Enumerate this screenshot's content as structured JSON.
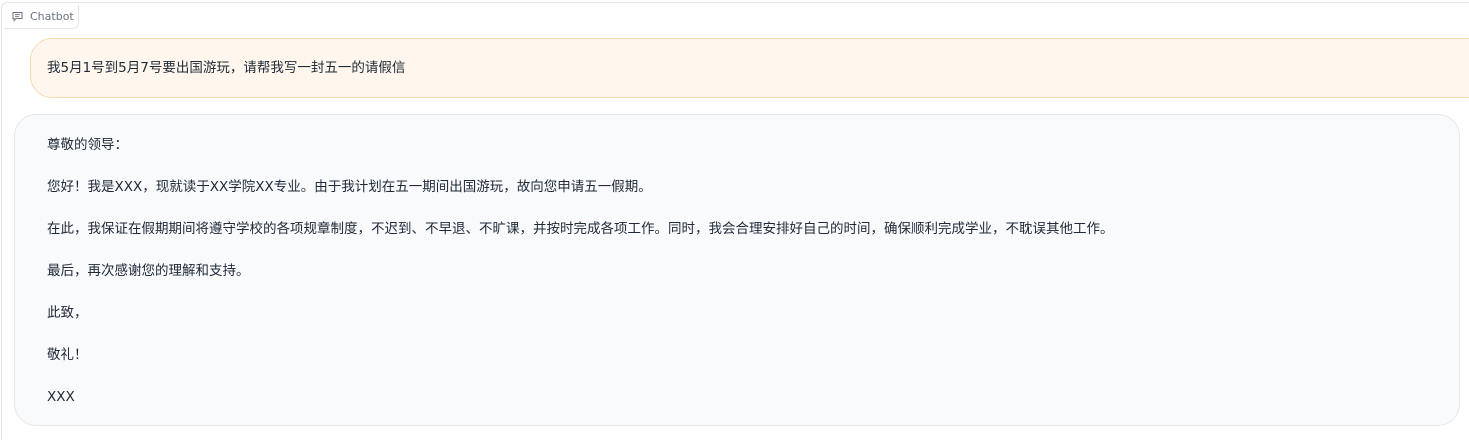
{
  "chatbot": {
    "label": "Chatbot",
    "icon": "chat-bubble-icon"
  },
  "messages": {
    "user": {
      "text": "我5月1号到5月7号要出国游玩，请帮我写一封五一的请假信"
    },
    "bot": {
      "paragraphs": [
        "尊敬的领导：",
        "您好！我是XXX，现就读于XX学院XX专业。由于我计划在五一期间出国游玩，故向您申请五一假期。",
        "在此，我保证在假期期间将遵守学校的各项规章制度，不迟到、不早退、不旷课，并按时完成各项工作。同时，我会合理安排好自己的时间，确保顺利完成学业，不耽误其他工作。",
        "最后，再次感谢您的理解和支持。",
        "此致，",
        "敬礼！",
        "XXX"
      ]
    }
  },
  "colors": {
    "user_bubble_bg": "#fff7ed",
    "user_bubble_border": "#fcd9b0",
    "bot_bubble_bg": "#f9fafb",
    "bot_bubble_border": "#e5e7eb"
  }
}
